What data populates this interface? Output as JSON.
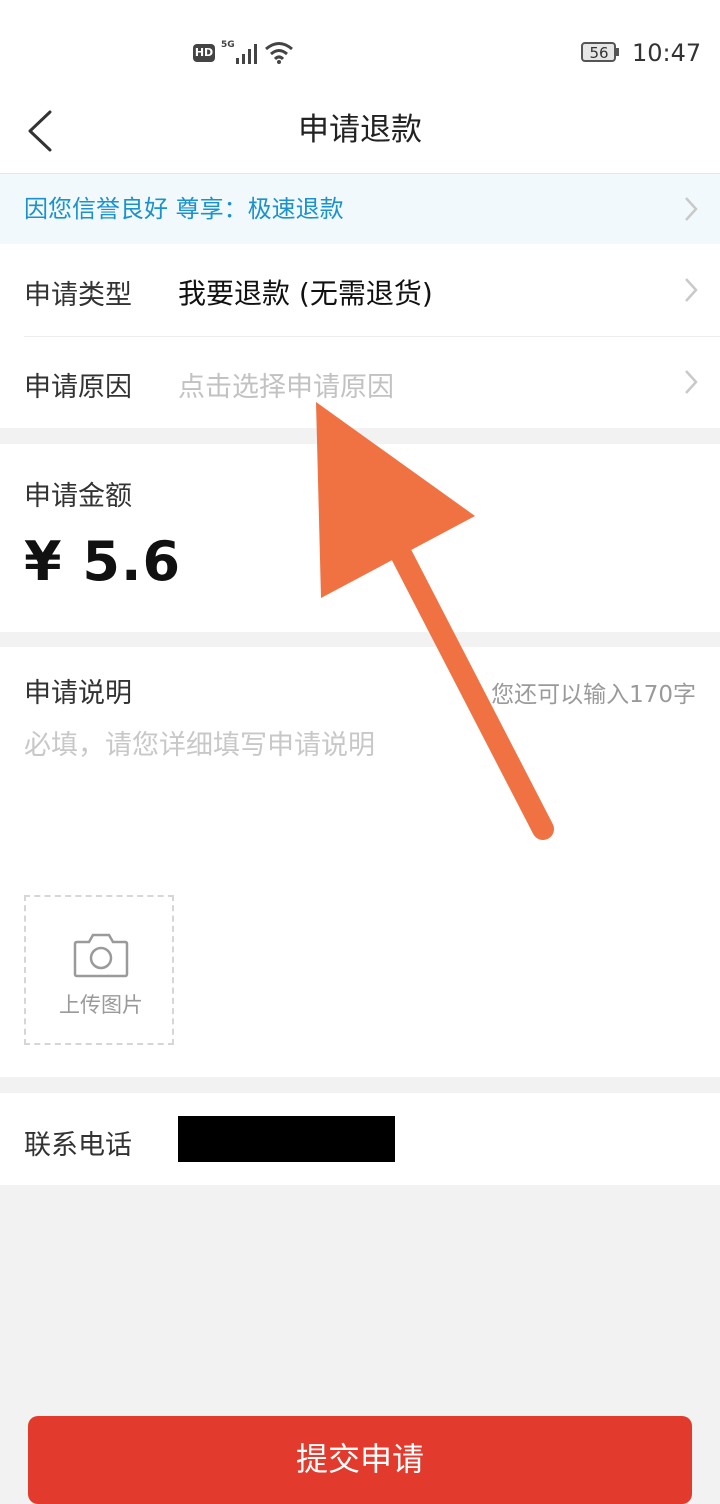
{
  "status_bar": {
    "hd": "HD",
    "network": "5G",
    "battery": "56",
    "time": "10:47"
  },
  "header": {
    "title": "申请退款",
    "back_icon": "chevron-left-icon"
  },
  "banner": {
    "text": "因您信誉良好 尊享：极速退款"
  },
  "form": {
    "type": {
      "label": "申请类型",
      "value": "我要退款 (无需退货)"
    },
    "reason": {
      "label": "申请原因",
      "placeholder": "点击选择申请原因"
    },
    "amount": {
      "label": "申请金额",
      "value": "¥ 5.6"
    },
    "description": {
      "label": "申请说明",
      "counter": "您还可以输入170字",
      "placeholder": "必填，请您详细填写申请说明"
    },
    "upload": {
      "label": "上传图片",
      "icon": "camera-icon"
    },
    "phone": {
      "label": "联系电话"
    }
  },
  "submit": {
    "label": "提交申请"
  },
  "colors": {
    "accent_blue": "#1b92cc",
    "submit_red": "#e23a2c",
    "annotation_arrow": "#f07242"
  }
}
